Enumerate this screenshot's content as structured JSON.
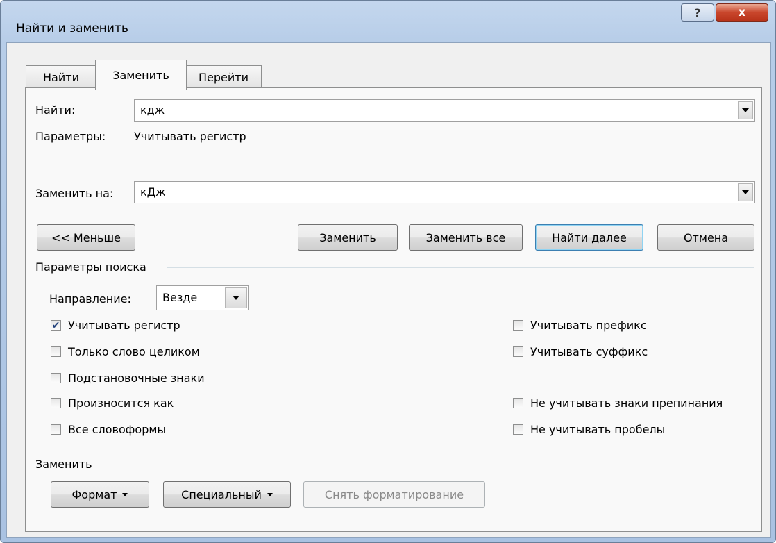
{
  "window": {
    "title": "Найти и заменить",
    "help_icon": "?",
    "close_icon": "x"
  },
  "tabs": [
    {
      "label": "Найти",
      "active": false
    },
    {
      "label": "Заменить",
      "active": true
    },
    {
      "label": "Перейти",
      "active": false
    }
  ],
  "find": {
    "label": "Найти:",
    "value": "кдж",
    "params_label": "Параметры:",
    "params_value": "Учитывать регистр"
  },
  "replace": {
    "label": "Заменить на:",
    "value": "кДж"
  },
  "buttons": {
    "less": "<< Меньше",
    "replace": "Заменить",
    "replace_all": "Заменить все",
    "find_next": "Найти далее",
    "cancel": "Отмена"
  },
  "search_options": {
    "group_label": "Параметры поиска",
    "direction_label": "Направление:",
    "direction_value": "Везде",
    "left": [
      {
        "label": "Учитывать регистр",
        "checked": true
      },
      {
        "label": "Только слово целиком",
        "checked": false
      },
      {
        "label": "Подстановочные знаки",
        "checked": false
      },
      {
        "label": "Произносится как",
        "checked": false
      },
      {
        "label": "Все словоформы",
        "checked": false
      }
    ],
    "right": [
      {
        "label": "Учитывать префикс",
        "checked": false
      },
      {
        "label": "Учитывать суффикс",
        "checked": false
      },
      {
        "label": "Не учитывать знаки препинания",
        "checked": false
      },
      {
        "label": "Не учитывать пробелы",
        "checked": false
      }
    ]
  },
  "replace_group": {
    "label": "Заменить",
    "format": "Формат",
    "special": "Специальный",
    "clear_formatting": "Снять форматирование"
  },
  "colors": {
    "title_bar": "#b9cfe9",
    "close_button": "#c9462c",
    "checkmark": "#1d3c78"
  }
}
